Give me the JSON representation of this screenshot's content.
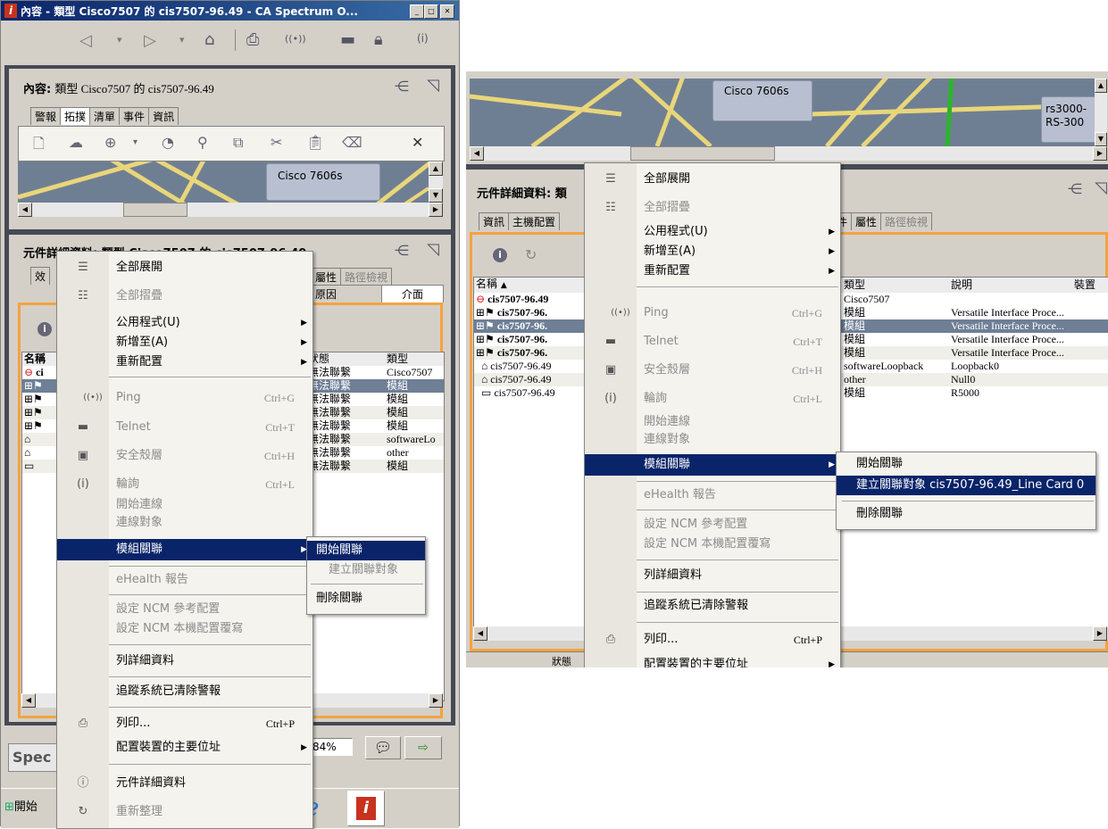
{
  "left": {
    "title": "內容 - 類型 Cisco7507 的 cis7507-96.49 - CA Spectrum O...",
    "content_label": "內容:",
    "content_value": "類型 Cisco7507 的 cis7507-96.49",
    "tabs": [
      "警報",
      "拓撲",
      "清單",
      "事件",
      "資訊"
    ],
    "topo_node": "Cisco 7606s",
    "details_title": "元件詳細資料: 類型 Cisco7507 的 cis7507-96.49",
    "detail_tabs_right": [
      "屬性",
      "路徑檢視"
    ],
    "detail_tabs_row2": [
      "原因",
      "介面"
    ],
    "detail_tab_partial": "效",
    "columns": [
      "名稱",
      "狀態",
      "類型"
    ],
    "rows": [
      {
        "name": "ci",
        "status": "無法聯繫",
        "type": "Cisco7507"
      },
      {
        "name": "",
        "status": "無法聯繫",
        "type": "模組"
      },
      {
        "name": "",
        "status": "無法聯繫",
        "type": "模組"
      },
      {
        "name": "",
        "status": "無法聯繫",
        "type": "模組"
      },
      {
        "name": "",
        "status": "無法聯繫",
        "type": "模組"
      },
      {
        "name": "",
        "status": "無法聯繫",
        "type": "softwareLo"
      },
      {
        "name": "",
        "status": "無法聯繫",
        "type": "other"
      },
      {
        "name": "",
        "status": "無法聯繫",
        "type": "模組"
      }
    ],
    "spec_button": "Spec",
    "percent": "84%",
    "start_label": "開始"
  },
  "left_menu": {
    "expand_all": "全部展開",
    "collapse_all": "全部摺疊",
    "utilities": "公用程式(U)",
    "new_to": "新增至(A)",
    "reconfigure": "重新配置",
    "ping": "Ping",
    "ping_sc": "Ctrl+G",
    "telnet": "Telnet",
    "telnet_sc": "Ctrl+T",
    "ssh": "安全殼層",
    "ssh_sc": "Ctrl+H",
    "poll": "輪詢",
    "poll_sc": "Ctrl+L",
    "start_conn": "開始連線",
    "conn_target": "連線對象",
    "module_assoc": "模組關聯",
    "ehealth": "eHealth 報告",
    "ncm_ref": "設定 NCM 參考配置",
    "ncm_local": "設定 NCM 本機配置覆寫",
    "list_details": "列詳細資料",
    "track_alarms": "追蹤系統已清除警報",
    "print": "列印...",
    "print_sc": "Ctrl+P",
    "primary_addr": "配置裝置的主要位址",
    "comp_details": "元件詳細資料",
    "refresh": "重新整理"
  },
  "left_submenu": {
    "start_assoc": "開始關聯",
    "create_assoc": "建立關聯對象",
    "delete_assoc": "刪除關聯"
  },
  "right": {
    "topo_node": "Cisco 7606s",
    "topo_node2_l1": "rs3000-",
    "topo_node2_l2": "RS-300",
    "details_title": "元件詳細資料: 類",
    "tabs_left": [
      "資訊",
      "主機配置"
    ],
    "tabs_right": [
      "件",
      "屬性",
      "路徑檢視"
    ],
    "columns": [
      "名稱",
      "類型",
      "說明",
      "裝置"
    ],
    "rows": [
      {
        "name": "cis7507-96.49",
        "type": "Cisco7507",
        "desc": ""
      },
      {
        "name": "cis7507-96.",
        "type": "模組",
        "desc": "Versatile Interface Proce..."
      },
      {
        "name": "cis7507-96.",
        "type": "模組",
        "desc": "Versatile Interface Proce..."
      },
      {
        "name": "cis7507-96.",
        "type": "模組",
        "desc": "Versatile Interface Proce..."
      },
      {
        "name": "cis7507-96.",
        "type": "模組",
        "desc": "Versatile Interface Proce..."
      },
      {
        "name": "cis7507-96.49",
        "type": "softwareLoopback",
        "desc": "Loopback0"
      },
      {
        "name": "cis7507-96.49",
        "type": "other",
        "desc": "Null0"
      },
      {
        "name": "cis7507-96.49",
        "type": "模組",
        "desc": "R5000"
      }
    ],
    "bottom_partial": "狀態"
  },
  "right_menu": {
    "expand_all": "全部展開",
    "collapse_all": "全部摺疊",
    "utilities": "公用程式(U)",
    "new_to": "新增至(A)",
    "reconfigure": "重新配置",
    "ping": "Ping",
    "ping_sc": "Ctrl+G",
    "telnet": "Telnet",
    "telnet_sc": "Ctrl+T",
    "ssh": "安全殼層",
    "ssh_sc": "Ctrl+H",
    "poll": "輪詢",
    "poll_sc": "Ctrl+L",
    "start_conn": "開始連線",
    "conn_target": "連線對象",
    "module_assoc": "模組關聯",
    "ehealth": "eHealth 報告",
    "ncm_ref": "設定 NCM 參考配置",
    "ncm_local": "設定 NCM 本機配置覆寫",
    "list_details": "列詳細資料",
    "track_alarms": "追蹤系統已清除警報",
    "print": "列印...",
    "print_sc": "Ctrl+P",
    "primary_addr": "配置裝置的主要位址"
  },
  "right_submenu": {
    "start_assoc": "開始關聯",
    "create_assoc": "建立關聯對象 cis7507-96.49_Line Card 0",
    "delete_assoc": "刪除關聯"
  },
  "colors": {
    "highlight": "#0a246a",
    "orange_border": "#f4a340",
    "topo_bg": "#6f7f93",
    "title_bar": "#0a246a"
  }
}
